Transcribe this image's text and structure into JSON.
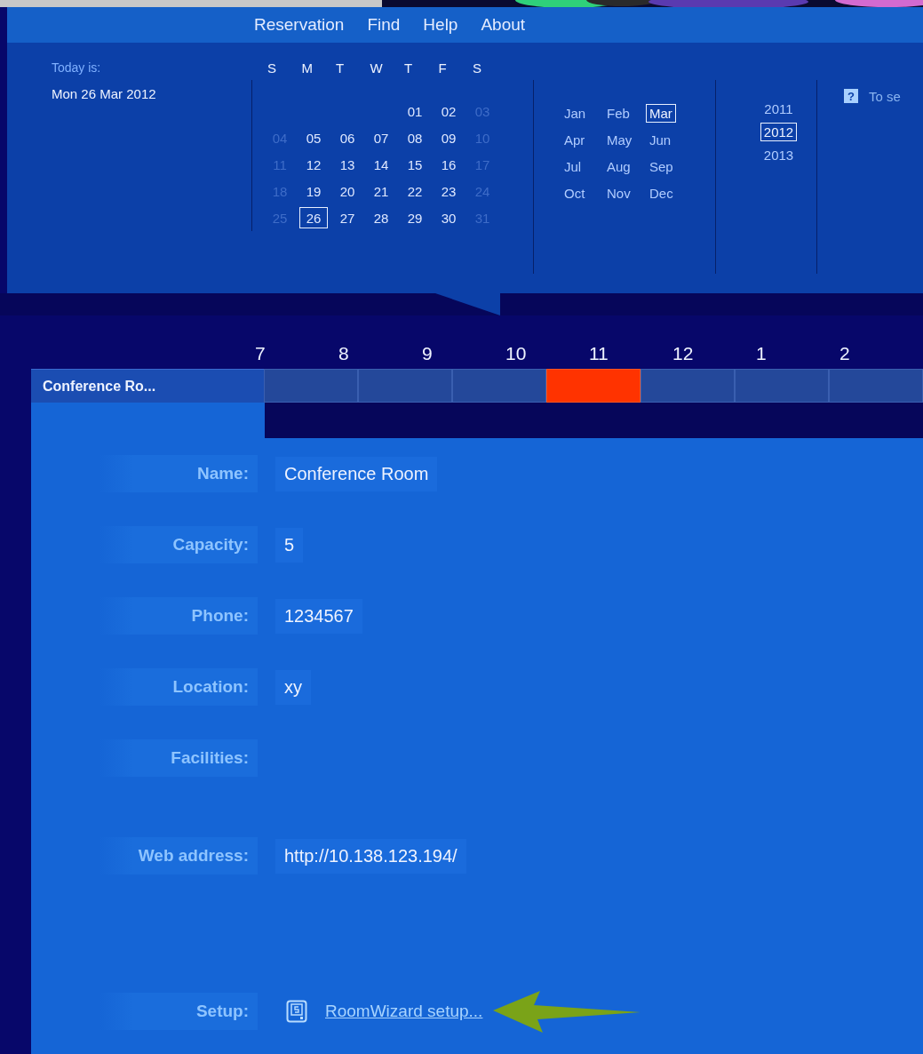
{
  "menu": [
    {
      "label": "Reservation"
    },
    {
      "label": "Find"
    },
    {
      "label": "Help"
    },
    {
      "label": "About"
    }
  ],
  "today": {
    "label": "Today is:",
    "date": "Mon 26 Mar 2012"
  },
  "calendar": {
    "weekdays": [
      "S",
      "M",
      "T",
      "W",
      "T",
      "F",
      "S"
    ],
    "weeks": [
      [
        {
          "day": "01",
          "muted": false,
          "selected": false
        },
        {
          "day": "02",
          "muted": false,
          "selected": false
        },
        {
          "day": "03",
          "muted": true,
          "selected": false
        }
      ],
      [
        {
          "day": "04",
          "muted": true,
          "selected": false
        },
        {
          "day": "05",
          "muted": false,
          "selected": false
        },
        {
          "day": "06",
          "muted": false,
          "selected": false
        },
        {
          "day": "07",
          "muted": false,
          "selected": false
        },
        {
          "day": "08",
          "muted": false,
          "selected": false
        },
        {
          "day": "09",
          "muted": false,
          "selected": false
        },
        {
          "day": "10",
          "muted": true,
          "selected": false
        }
      ],
      [
        {
          "day": "11",
          "muted": true,
          "selected": false
        },
        {
          "day": "12",
          "muted": false,
          "selected": false
        },
        {
          "day": "13",
          "muted": false,
          "selected": false
        },
        {
          "day": "14",
          "muted": false,
          "selected": false
        },
        {
          "day": "15",
          "muted": false,
          "selected": false
        },
        {
          "day": "16",
          "muted": false,
          "selected": false
        },
        {
          "day": "17",
          "muted": true,
          "selected": false
        }
      ],
      [
        {
          "day": "18",
          "muted": true,
          "selected": false
        },
        {
          "day": "19",
          "muted": false,
          "selected": false
        },
        {
          "day": "20",
          "muted": false,
          "selected": false
        },
        {
          "day": "21",
          "muted": false,
          "selected": false
        },
        {
          "day": "22",
          "muted": false,
          "selected": false
        },
        {
          "day": "23",
          "muted": false,
          "selected": false
        },
        {
          "day": "24",
          "muted": true,
          "selected": false
        }
      ],
      [
        {
          "day": "25",
          "muted": true,
          "selected": false
        },
        {
          "day": "26",
          "muted": false,
          "selected": true
        },
        {
          "day": "27",
          "muted": false,
          "selected": false
        },
        {
          "day": "28",
          "muted": false,
          "selected": false
        },
        {
          "day": "29",
          "muted": false,
          "selected": false
        },
        {
          "day": "30",
          "muted": false,
          "selected": false
        },
        {
          "day": "31",
          "muted": true,
          "selected": false
        }
      ]
    ]
  },
  "months": [
    {
      "label": "Jan",
      "selected": false
    },
    {
      "label": "Feb",
      "selected": false
    },
    {
      "label": "Mar",
      "selected": true
    },
    {
      "label": "Apr",
      "selected": false
    },
    {
      "label": "May",
      "selected": false
    },
    {
      "label": "Jun",
      "selected": false
    },
    {
      "label": "Jul",
      "selected": false
    },
    {
      "label": "Aug",
      "selected": false
    },
    {
      "label": "Sep",
      "selected": false
    },
    {
      "label": "Oct",
      "selected": false
    },
    {
      "label": "Nov",
      "selected": false
    },
    {
      "label": "Dec",
      "selected": false
    }
  ],
  "years": [
    {
      "label": "2011",
      "selected": false
    },
    {
      "label": "2012",
      "selected": true
    },
    {
      "label": "2013",
      "selected": false
    }
  ],
  "help": {
    "icon": "?",
    "text": "To se"
  },
  "timeline": {
    "hours": [
      "7",
      "8",
      "9",
      "10",
      "11",
      "12",
      "1",
      "2"
    ],
    "room": "Conference Ro...",
    "slots": [
      {
        "booked": false
      },
      {
        "booked": false
      },
      {
        "booked": false
      },
      {
        "booked": true
      },
      {
        "booked": false
      },
      {
        "booked": false
      },
      {
        "booked": false
      }
    ]
  },
  "details": [
    {
      "kind": "text",
      "label": "Name:",
      "value": "Conference Room"
    },
    {
      "kind": "text",
      "label": "Capacity:",
      "value": "5"
    },
    {
      "kind": "text",
      "label": "Phone:",
      "value": "1234567"
    },
    {
      "kind": "text",
      "label": "Location:",
      "value": "xy"
    },
    {
      "kind": "text",
      "label": "Facilities:"
    },
    {
      "kind": "text",
      "label": "Web address:",
      "value": "http://10.138.123.194/"
    },
    {
      "kind": "link",
      "label": "Setup:",
      "value": "RoomWizard setup..."
    }
  ]
}
